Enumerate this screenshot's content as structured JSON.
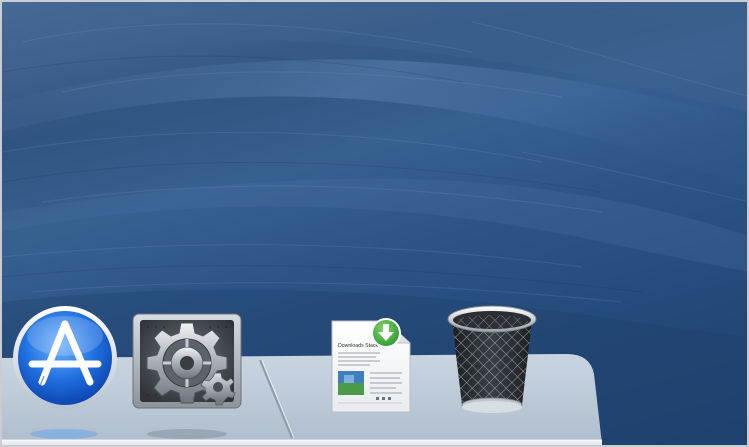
{
  "dock": {
    "items": [
      {
        "name": "app-store",
        "icon": "app-store-icon"
      },
      {
        "name": "system-preferences",
        "icon": "gear-icon"
      },
      {
        "name": "downloads-stack",
        "icon": "document-download-icon",
        "document_title": "Downloads Stack"
      },
      {
        "name": "trash",
        "icon": "trash-icon"
      }
    ]
  },
  "colors": {
    "wallpaper_deep": "#1f4271",
    "wallpaper_light": "#4d76a6",
    "dock_shelf": "#c3d0dc",
    "app_store_blue": "#1f6fe0",
    "download_badge_green": "#2f9b2f"
  }
}
